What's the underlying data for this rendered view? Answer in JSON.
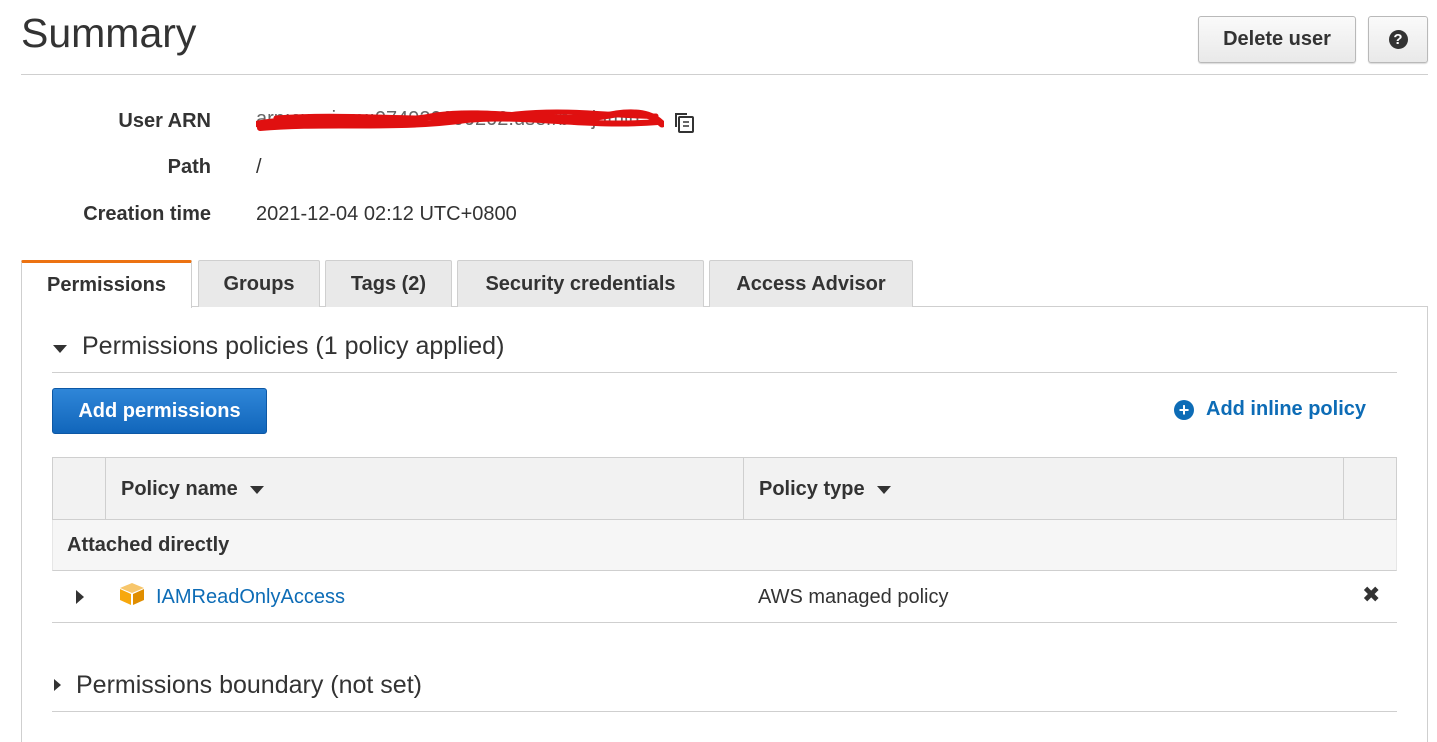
{
  "page": {
    "title": "Summary",
    "delete_label": "Delete user",
    "help_icon": "question-circle-icon",
    "help_glyph": "?"
  },
  "summary": {
    "arn_label": "User ARN",
    "arn_value": "arn:aws:iam::074920600202:user/benjamin",
    "path_label": "Path",
    "path_value": "/",
    "creation_label": "Creation time",
    "creation_value": "2021-12-04 02:12 UTC+0800",
    "redaction_color": "#e01010"
  },
  "tabs": [
    {
      "label": "Permissions",
      "active": true
    },
    {
      "label": "Groups",
      "active": false
    },
    {
      "label": "Tags (2)",
      "active": false
    },
    {
      "label": "Security credentials",
      "active": false
    },
    {
      "label": "Access Advisor",
      "active": false
    }
  ],
  "permissions": {
    "section_title": "Permissions policies (1 policy applied)",
    "add_label": "Add permissions",
    "inline_label": "Add inline policy",
    "inline_glyph": "+",
    "columns": [
      "Policy name",
      "Policy type"
    ],
    "group_label": "Attached directly",
    "rows": [
      {
        "name": "IAMReadOnlyAccess",
        "type": "AWS managed policy",
        "icon": "aws-managed-cube-icon"
      }
    ],
    "remove_glyph": "✖"
  },
  "boundary": {
    "section_title": "Permissions boundary (not set)"
  },
  "colors": {
    "accent_tab": "#ec7211",
    "primary_button": "#1166bb",
    "link": "#0d6cb6",
    "cube": "#f7a80d"
  }
}
